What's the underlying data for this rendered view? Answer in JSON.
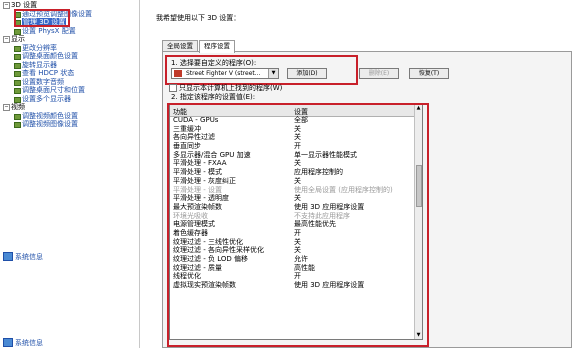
{
  "sidebar": {
    "tree": [
      {
        "kind": "cat",
        "label": "3D 设置",
        "toggle": "−"
      },
      {
        "kind": "item",
        "label": "通过预览调整图像设置"
      },
      {
        "kind": "item",
        "label": "管理 3D 设置",
        "selected": true
      },
      {
        "kind": "item",
        "label": "设置 PhysX 配置"
      },
      {
        "kind": "cat",
        "label": "显示",
        "toggle": "−"
      },
      {
        "kind": "item",
        "label": "更改分辨率"
      },
      {
        "kind": "item",
        "label": "调整桌面颜色设置"
      },
      {
        "kind": "item",
        "label": "旋转显示器"
      },
      {
        "kind": "item",
        "label": "查看 HDCP 状态"
      },
      {
        "kind": "item",
        "label": "设置数字音频"
      },
      {
        "kind": "item",
        "label": "调整桌面尺寸和位置"
      },
      {
        "kind": "item",
        "label": "设置多个显示器"
      },
      {
        "kind": "cat",
        "label": "视频",
        "toggle": "−"
      },
      {
        "kind": "item",
        "label": "调整视频颜色设置"
      },
      {
        "kind": "item",
        "label": "调整视频图像设置"
      }
    ],
    "system_info": "系统信息"
  },
  "main": {
    "heading": "我希望使用以下 3D 设置：",
    "tabs": [
      "全局设置",
      "程序设置"
    ],
    "step1_label": "1. 选择要自定义的程序(O):",
    "program_combo_value": "Street Fighter V (street...",
    "add_button": "添加(D)",
    "remove_button": "删除(E)",
    "restore_button": "恢复(T)",
    "only_show_checkbox": "只显示本计算机上找到的程序(W)",
    "step2_label": "2. 指定该程序的设置值(E):",
    "columns": {
      "feature": "功能",
      "setting": "设置"
    },
    "rows": [
      {
        "feature": "CUDA - GPUs",
        "setting": "全部"
      },
      {
        "feature": "三重缓冲",
        "setting": "关"
      },
      {
        "feature": "各向异性过滤",
        "setting": "关"
      },
      {
        "feature": "垂直同步",
        "setting": "开"
      },
      {
        "feature": "多显示器/混合 GPU 加速",
        "setting": "单一显示器性能模式"
      },
      {
        "feature": "平滑处理 - FXAA",
        "setting": "关"
      },
      {
        "feature": "平滑处理 - 模式",
        "setting": "应用程序控制的"
      },
      {
        "feature": "平滑处理 - 灰度纠正",
        "setting": "关"
      },
      {
        "feature": "平滑处理 - 设置",
        "setting": "使用全局设置 (应用程序控制的)",
        "dim": true
      },
      {
        "feature": "平滑处理 - 透明度",
        "setting": "关"
      },
      {
        "feature": "最大预渲染帧数",
        "setting": "使用 3D 应用程序设置"
      },
      {
        "feature": "环境光吸收",
        "setting": "不支持此应用程序",
        "dim": true
      },
      {
        "feature": "电源管理模式",
        "setting": "最高性能优先"
      },
      {
        "feature": "着色缓存器",
        "setting": "开"
      },
      {
        "feature": "纹理过滤 - 三线性优化",
        "setting": "关"
      },
      {
        "feature": "纹理过滤 - 各向异性采样优化",
        "setting": "关"
      },
      {
        "feature": "纹理过滤 - 负 LOD 偏移",
        "setting": "允许"
      },
      {
        "feature": "纹理过滤 - 质量",
        "setting": "高性能"
      },
      {
        "feature": "线程优化",
        "setting": "开"
      },
      {
        "feature": "虚拟现实预渲染帧数",
        "setting": "使用 3D 应用程序设置"
      }
    ]
  }
}
